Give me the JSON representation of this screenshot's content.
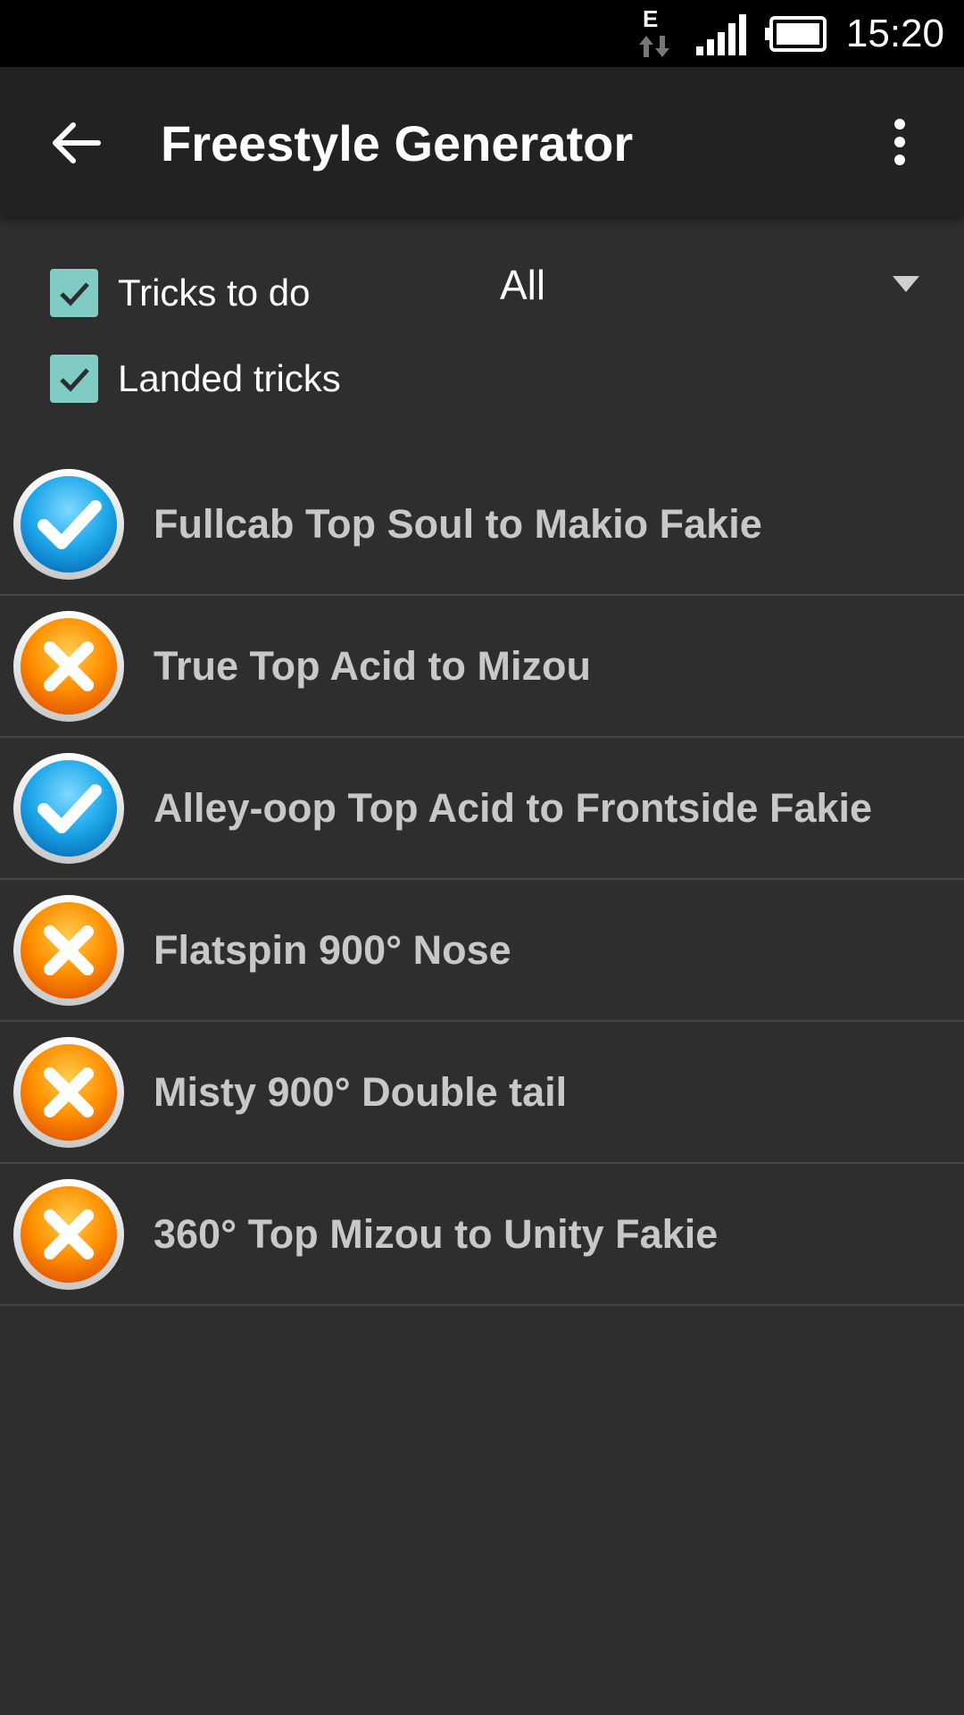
{
  "status_bar": {
    "time": "15:20",
    "network_type": "E",
    "icons": [
      "data-arrows-icon",
      "signal-icon",
      "battery-icon"
    ]
  },
  "app_bar": {
    "title": "Freestyle Generator",
    "back_icon": "arrow-back-icon",
    "menu_icon": "more-vert-icon"
  },
  "filters": {
    "tricks_to_do": {
      "label": "Tricks to do",
      "checked": true
    },
    "landed_tricks": {
      "label": "Landed tricks",
      "checked": true
    },
    "dropdown": {
      "selected": "All"
    }
  },
  "colors": {
    "background": "#2e2e2e",
    "app_bar": "#222222",
    "checkbox": "#80cbc4",
    "landed_blue": "#29b6f6",
    "todo_orange": "#ff8f00",
    "trick_text": "#c8c8c8"
  },
  "tricks": [
    {
      "label": "Fullcab Top Soul to Makio Fakie",
      "status": "landed"
    },
    {
      "label": "True Top Acid to Mizou",
      "status": "todo"
    },
    {
      "label": "Alley-oop Top Acid to Frontside Fakie",
      "status": "landed"
    },
    {
      "label": "Flatspin 900° Nose",
      "status": "todo"
    },
    {
      "label": "Misty 900° Double tail",
      "status": "todo"
    },
    {
      "label": "360° Top Mizou to Unity Fakie",
      "status": "todo"
    }
  ]
}
